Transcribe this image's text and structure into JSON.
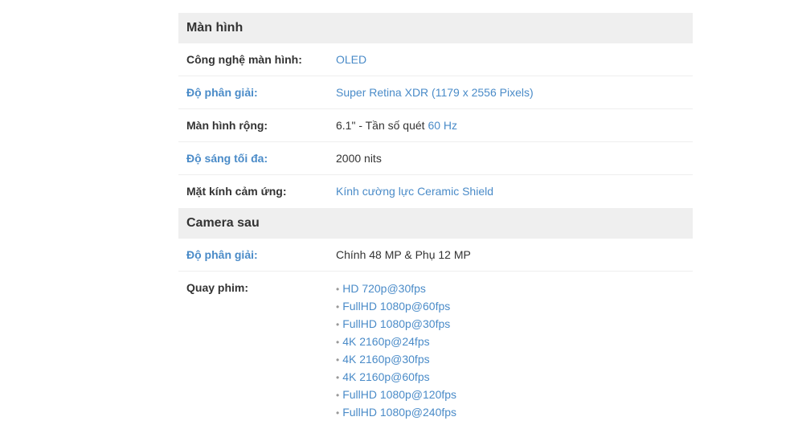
{
  "sections": [
    {
      "title": "Màn hình",
      "rows": [
        {
          "label": "Công nghệ màn hình:",
          "value": "OLED"
        },
        {
          "label": "Độ phân giải:",
          "value": "Super Retina XDR (1179 x 2556 Pixels)"
        },
        {
          "label": "Màn hình rộng:",
          "value_prefix": "6.1\" - Tần số quét ",
          "value_link": "60 Hz"
        },
        {
          "label": "Độ sáng tối đa:",
          "value": "2000 nits"
        },
        {
          "label": "Mặt kính cảm ứng:",
          "value": "Kính cường lực Ceramic Shield"
        }
      ]
    },
    {
      "title": "Camera sau",
      "rows": [
        {
          "label": "Độ phân giải:",
          "value": "Chính 48 MP & Phụ 12 MP"
        },
        {
          "label": "Quay phim:",
          "items": [
            "HD 720p@30fps",
            "FullHD 1080p@60fps",
            "FullHD 1080p@30fps",
            "4K 2160p@24fps",
            "4K 2160p@30fps",
            "4K 2160p@60fps",
            "FullHD 1080p@120fps",
            "FullHD 1080p@240fps"
          ]
        }
      ]
    }
  ],
  "colors": {
    "link": "#4a8bc8",
    "text": "#333333",
    "header_bg": "#efefef"
  },
  "bullet_glyph": "•"
}
